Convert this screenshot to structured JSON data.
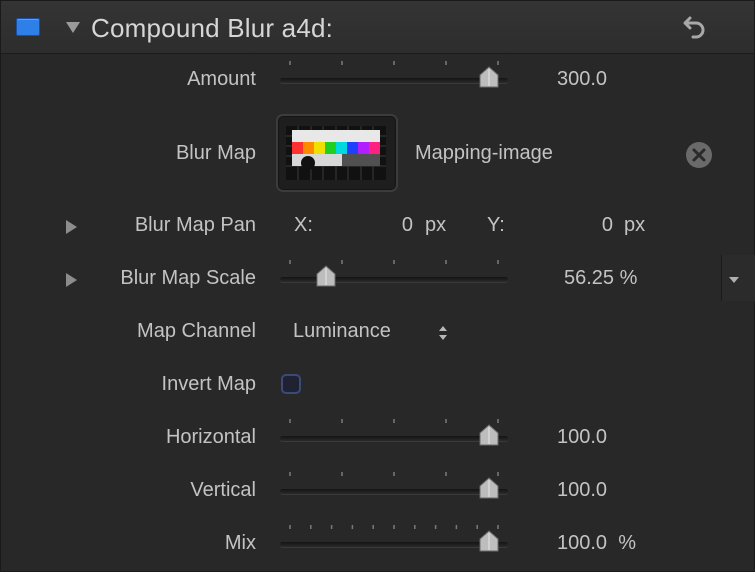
{
  "header": {
    "title": "Compound Blur a4d:",
    "enable_color": "#2f7fe8"
  },
  "params": {
    "amount": {
      "label": "Amount",
      "value": "300.0",
      "slider_fraction": 0.95
    },
    "blur_map": {
      "label": "Blur Map",
      "source": "Mapping-image"
    },
    "blur_map_pan": {
      "label": "Blur Map Pan",
      "x_label": "X:",
      "x_value": "0",
      "x_unit": "px",
      "y_label": "Y:",
      "y_value": "0",
      "y_unit": "px"
    },
    "blur_map_scale": {
      "label": "Blur Map Scale",
      "value": "56.25",
      "unit": "%",
      "slider_fraction": 0.18
    },
    "map_channel": {
      "label": "Map Channel",
      "value": "Luminance"
    },
    "invert_map": {
      "label": "Invert Map",
      "checked": false
    },
    "horizontal": {
      "label": "Horizontal",
      "value": "100.0",
      "slider_fraction": 0.95
    },
    "vertical": {
      "label": "Vertical",
      "value": "100.0",
      "slider_fraction": 0.95
    },
    "mix": {
      "label": "Mix",
      "value": "100.0",
      "unit": "%",
      "slider_fraction": 0.95
    }
  },
  "icons": {
    "reset": "reset-arrow-icon",
    "clear": "clear-x-icon",
    "stepper": "up-down-stepper-icon"
  }
}
